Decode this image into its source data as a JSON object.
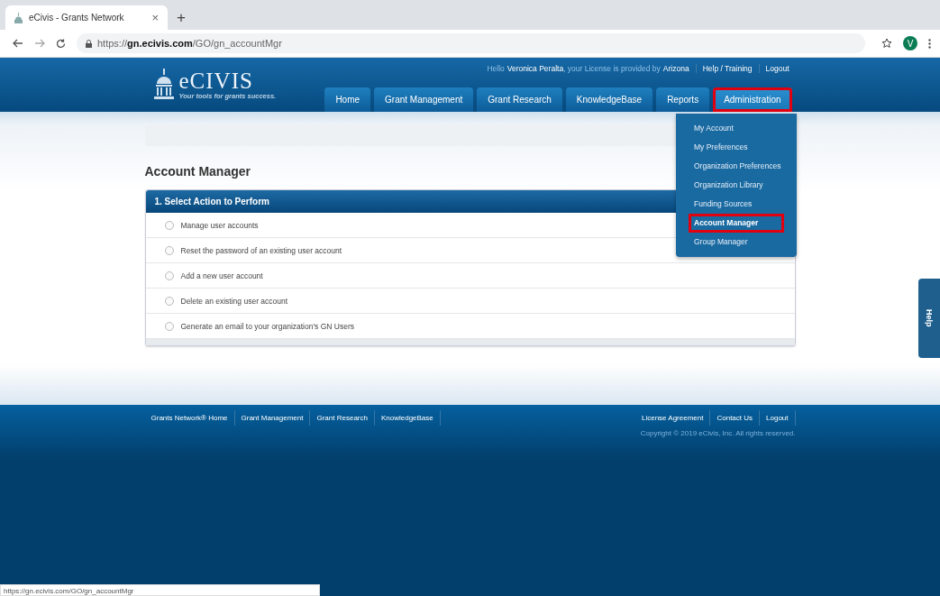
{
  "browser": {
    "tab": {
      "title": "eCivis - Grants Network",
      "close": "×"
    },
    "new_tab": "+",
    "url": {
      "scheme": "https://",
      "host": "gn.ecivis.com",
      "path": "/GO/gn_accountMgr"
    },
    "profile_initial": "V",
    "status_url": "https://gn.ecivis.com/GO/gn_accountMgr"
  },
  "header": {
    "logo": {
      "name": "eCIVIS",
      "tagline": "Your tools for grants success."
    },
    "greeting": {
      "hello": "Hello",
      "name": "Veronica Peralta",
      "middle": ", your License is provided by",
      "provider": "Arizona"
    },
    "top_links": [
      "Help / Training",
      "Logout"
    ],
    "nav": [
      {
        "label": "Home",
        "selected": false,
        "highlighted": false
      },
      {
        "label": "Grant Management",
        "selected": false,
        "highlighted": false
      },
      {
        "label": "Grant Research",
        "selected": false,
        "highlighted": false
      },
      {
        "label": "KnowledgeBase",
        "selected": false,
        "highlighted": false
      },
      {
        "label": "Reports",
        "selected": false,
        "highlighted": false
      },
      {
        "label": "Administration",
        "selected": true,
        "highlighted": true
      }
    ]
  },
  "dropdown": [
    {
      "label": "My Account",
      "selected": false,
      "highlighted": false
    },
    {
      "label": "My Preferences",
      "selected": false,
      "highlighted": false
    },
    {
      "label": "Organization Preferences",
      "selected": false,
      "highlighted": false
    },
    {
      "label": "Organization Library",
      "selected": false,
      "highlighted": false
    },
    {
      "label": "Funding Sources",
      "selected": false,
      "highlighted": false
    },
    {
      "label": "Account Manager",
      "selected": true,
      "highlighted": true
    },
    {
      "label": "Group Manager",
      "selected": false,
      "highlighted": false
    }
  ],
  "page_title": "Account Manager",
  "panel": {
    "title": "1. Select Action to Perform",
    "options": [
      {
        "label": "Manage user accounts",
        "selected": false
      },
      {
        "label": "Reset the password of an existing user account",
        "selected": false
      },
      {
        "label": "Add a new user account",
        "selected": false
      },
      {
        "label": "Delete an existing user account",
        "selected": false
      },
      {
        "label": "Generate an email to your organization's GN Users",
        "selected": false
      }
    ]
  },
  "help_tab": "Help",
  "footer": {
    "left_links": [
      "Grants Network® Home",
      "Grant Management",
      "Grant Research",
      "KnowledgeBase"
    ],
    "right_links": [
      "License Agreement",
      "Contact Us",
      "Logout"
    ],
    "copyright": "Copyright © 2019 eCivis, Inc. All rights reserved."
  }
}
